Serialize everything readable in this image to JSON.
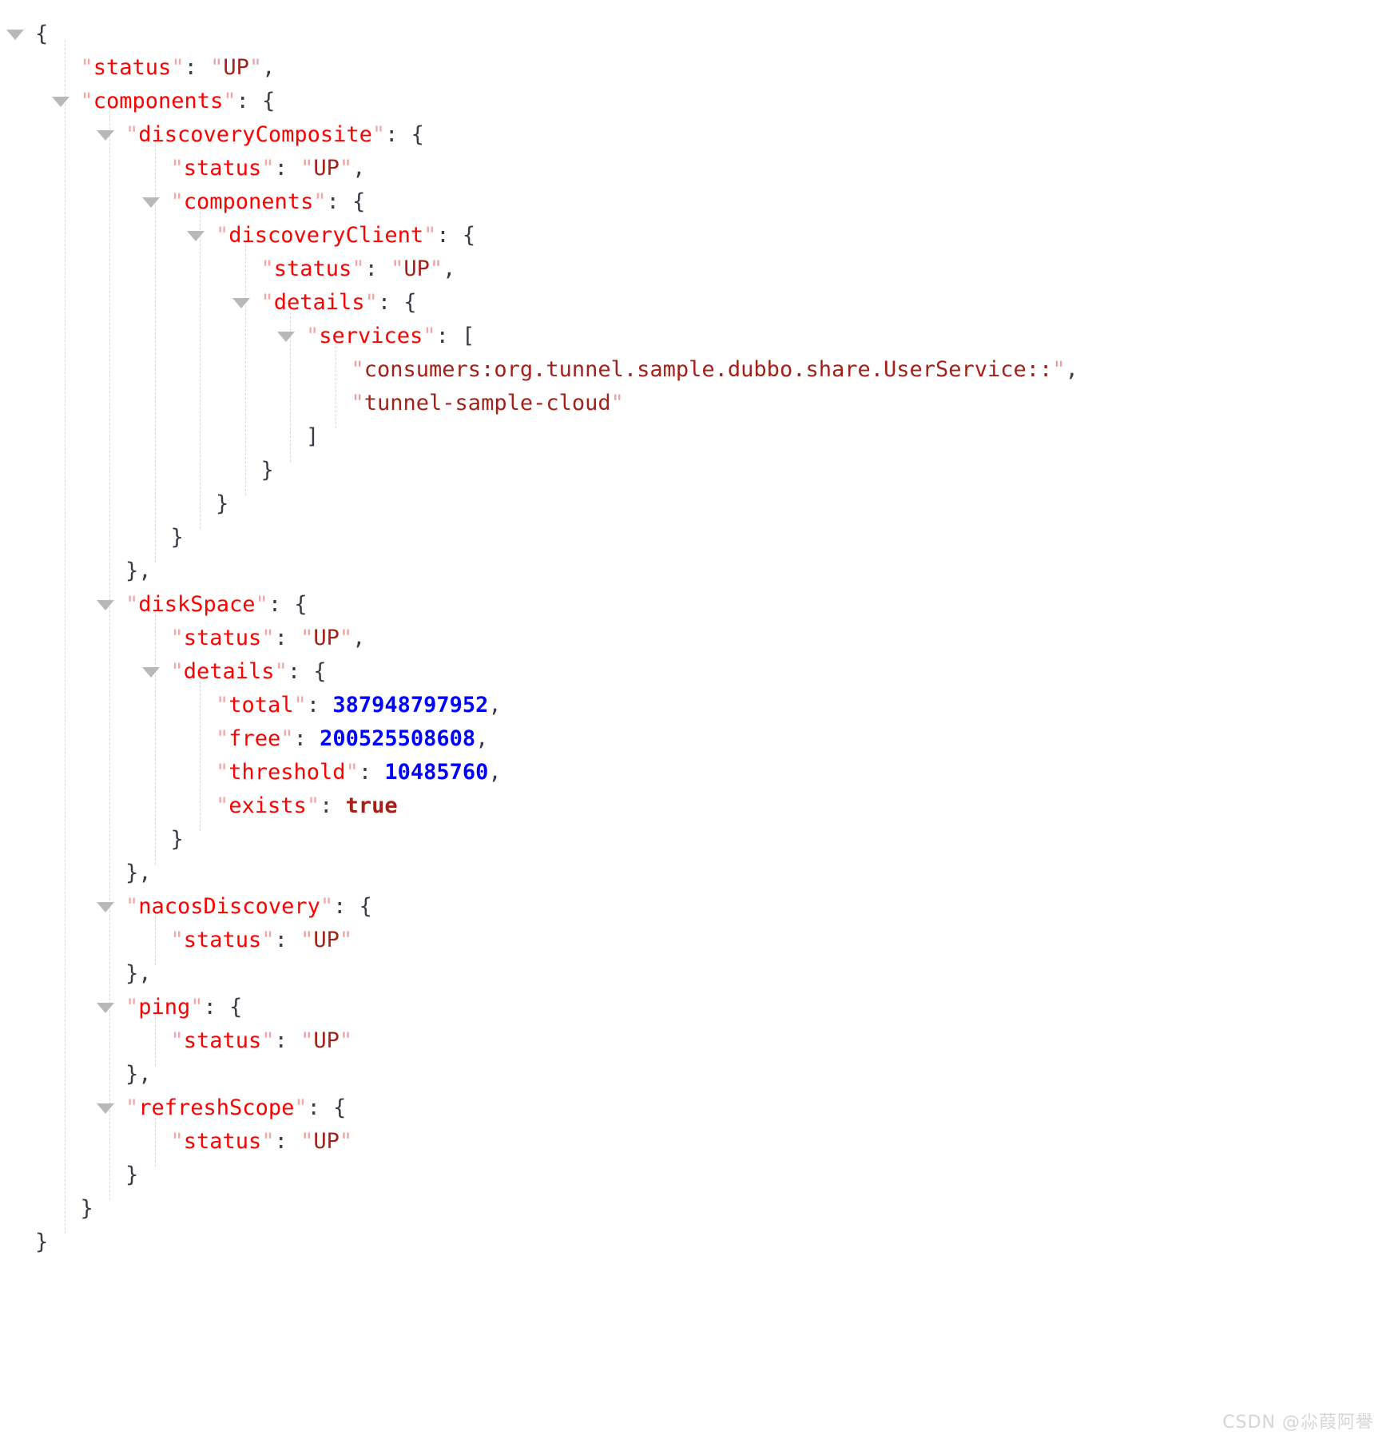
{
  "viewer": {
    "type": "json-tree-viewer",
    "colors": {
      "key": "#ff0000",
      "string_value": "#a52019",
      "number_value": "#0000ff",
      "boolean_value": "#a52019",
      "punctuation": "#3b3b46",
      "quote": "#f0a8a8",
      "guide_line": "#d8d8d8",
      "twisty": "#b8b8b8",
      "background": "#ffffff"
    }
  },
  "watermark": {
    "text": "CSDN @尛葭阿譽"
  },
  "json_document": {
    "status": "UP",
    "components": {
      "discoveryComposite": {
        "status": "UP",
        "components": {
          "discoveryClient": {
            "status": "UP",
            "details": {
              "services": [
                "consumers:org.tunnel.sample.dubbo.share.UserService::",
                "tunnel-sample-cloud"
              ]
            }
          }
        }
      },
      "diskSpace": {
        "status": "UP",
        "details": {
          "total": 387948797952,
          "free": 200525508608,
          "threshold": 10485760,
          "exists": true
        }
      },
      "nacosDiscovery": {
        "status": "UP"
      },
      "ping": {
        "status": "UP"
      },
      "refreshScope": {
        "status": "UP"
      }
    }
  },
  "lines": [
    {
      "id": "l0",
      "indent": 0,
      "twisty": true,
      "tokens": [
        {
          "t": "p",
          "v": "{"
        }
      ]
    },
    {
      "id": "l1",
      "indent": 1,
      "twisty": false,
      "tokens": [
        {
          "t": "q",
          "v": "\""
        },
        {
          "t": "k",
          "v": "status"
        },
        {
          "t": "q",
          "v": "\""
        },
        {
          "t": "p",
          "v": ": "
        },
        {
          "t": "qv",
          "v": "\""
        },
        {
          "t": "s",
          "v": "UP"
        },
        {
          "t": "qv",
          "v": "\""
        },
        {
          "t": "p",
          "v": ","
        }
      ]
    },
    {
      "id": "l2",
      "indent": 1,
      "twisty": true,
      "tokens": [
        {
          "t": "q",
          "v": "\""
        },
        {
          "t": "k",
          "v": "components"
        },
        {
          "t": "q",
          "v": "\""
        },
        {
          "t": "p",
          "v": ": {"
        }
      ]
    },
    {
      "id": "l3",
      "indent": 2,
      "twisty": true,
      "tokens": [
        {
          "t": "q",
          "v": "\""
        },
        {
          "t": "k",
          "v": "discoveryComposite"
        },
        {
          "t": "q",
          "v": "\""
        },
        {
          "t": "p",
          "v": ": {"
        }
      ]
    },
    {
      "id": "l4",
      "indent": 3,
      "twisty": false,
      "tokens": [
        {
          "t": "q",
          "v": "\""
        },
        {
          "t": "k",
          "v": "status"
        },
        {
          "t": "q",
          "v": "\""
        },
        {
          "t": "p",
          "v": ": "
        },
        {
          "t": "qv",
          "v": "\""
        },
        {
          "t": "s",
          "v": "UP"
        },
        {
          "t": "qv",
          "v": "\""
        },
        {
          "t": "p",
          "v": ","
        }
      ]
    },
    {
      "id": "l5",
      "indent": 3,
      "twisty": true,
      "tokens": [
        {
          "t": "q",
          "v": "\""
        },
        {
          "t": "k",
          "v": "components"
        },
        {
          "t": "q",
          "v": "\""
        },
        {
          "t": "p",
          "v": ": {"
        }
      ]
    },
    {
      "id": "l6",
      "indent": 4,
      "twisty": true,
      "tokens": [
        {
          "t": "q",
          "v": "\""
        },
        {
          "t": "k",
          "v": "discoveryClient"
        },
        {
          "t": "q",
          "v": "\""
        },
        {
          "t": "p",
          "v": ": {"
        }
      ]
    },
    {
      "id": "l7",
      "indent": 5,
      "twisty": false,
      "tokens": [
        {
          "t": "q",
          "v": "\""
        },
        {
          "t": "k",
          "v": "status"
        },
        {
          "t": "q",
          "v": "\""
        },
        {
          "t": "p",
          "v": ": "
        },
        {
          "t": "qv",
          "v": "\""
        },
        {
          "t": "s",
          "v": "UP"
        },
        {
          "t": "qv",
          "v": "\""
        },
        {
          "t": "p",
          "v": ","
        }
      ]
    },
    {
      "id": "l8",
      "indent": 5,
      "twisty": true,
      "tokens": [
        {
          "t": "q",
          "v": "\""
        },
        {
          "t": "k",
          "v": "details"
        },
        {
          "t": "q",
          "v": "\""
        },
        {
          "t": "p",
          "v": ": {"
        }
      ]
    },
    {
      "id": "l9",
      "indent": 6,
      "twisty": true,
      "tokens": [
        {
          "t": "q",
          "v": "\""
        },
        {
          "t": "k",
          "v": "services"
        },
        {
          "t": "q",
          "v": "\""
        },
        {
          "t": "p",
          "v": ": ["
        }
      ]
    },
    {
      "id": "l10",
      "indent": 7,
      "twisty": false,
      "tokens": [
        {
          "t": "qv",
          "v": "\""
        },
        {
          "t": "s",
          "v": "consumers:org.tunnel.sample.dubbo.share.UserService::"
        },
        {
          "t": "qv",
          "v": "\""
        },
        {
          "t": "p",
          "v": ","
        }
      ]
    },
    {
      "id": "l11",
      "indent": 7,
      "twisty": false,
      "tokens": [
        {
          "t": "qv",
          "v": "\""
        },
        {
          "t": "s",
          "v": "tunnel-sample-cloud"
        },
        {
          "t": "qv",
          "v": "\""
        }
      ]
    },
    {
      "id": "l12",
      "indent": 6,
      "twisty": false,
      "tokens": [
        {
          "t": "p",
          "v": "]"
        }
      ]
    },
    {
      "id": "l13",
      "indent": 5,
      "twisty": false,
      "tokens": [
        {
          "t": "p",
          "v": "}"
        }
      ]
    },
    {
      "id": "l14",
      "indent": 4,
      "twisty": false,
      "tokens": [
        {
          "t": "p",
          "v": "}"
        }
      ]
    },
    {
      "id": "l15",
      "indent": 3,
      "twisty": false,
      "tokens": [
        {
          "t": "p",
          "v": "}"
        }
      ]
    },
    {
      "id": "l16",
      "indent": 2,
      "twisty": false,
      "tokens": [
        {
          "t": "p",
          "v": "},"
        }
      ]
    },
    {
      "id": "l17",
      "indent": 2,
      "twisty": true,
      "tokens": [
        {
          "t": "q",
          "v": "\""
        },
        {
          "t": "k",
          "v": "diskSpace"
        },
        {
          "t": "q",
          "v": "\""
        },
        {
          "t": "p",
          "v": ": {"
        }
      ]
    },
    {
      "id": "l18",
      "indent": 3,
      "twisty": false,
      "tokens": [
        {
          "t": "q",
          "v": "\""
        },
        {
          "t": "k",
          "v": "status"
        },
        {
          "t": "q",
          "v": "\""
        },
        {
          "t": "p",
          "v": ": "
        },
        {
          "t": "qv",
          "v": "\""
        },
        {
          "t": "s",
          "v": "UP"
        },
        {
          "t": "qv",
          "v": "\""
        },
        {
          "t": "p",
          "v": ","
        }
      ]
    },
    {
      "id": "l19",
      "indent": 3,
      "twisty": true,
      "tokens": [
        {
          "t": "q",
          "v": "\""
        },
        {
          "t": "k",
          "v": "details"
        },
        {
          "t": "q",
          "v": "\""
        },
        {
          "t": "p",
          "v": ": {"
        }
      ]
    },
    {
      "id": "l20",
      "indent": 4,
      "twisty": false,
      "tokens": [
        {
          "t": "q",
          "v": "\""
        },
        {
          "t": "k",
          "v": "total"
        },
        {
          "t": "q",
          "v": "\""
        },
        {
          "t": "p",
          "v": ": "
        },
        {
          "t": "n",
          "v": "387948797952"
        },
        {
          "t": "p",
          "v": ","
        }
      ]
    },
    {
      "id": "l21",
      "indent": 4,
      "twisty": false,
      "tokens": [
        {
          "t": "q",
          "v": "\""
        },
        {
          "t": "k",
          "v": "free"
        },
        {
          "t": "q",
          "v": "\""
        },
        {
          "t": "p",
          "v": ": "
        },
        {
          "t": "n",
          "v": "200525508608"
        },
        {
          "t": "p",
          "v": ","
        }
      ]
    },
    {
      "id": "l22",
      "indent": 4,
      "twisty": false,
      "tokens": [
        {
          "t": "q",
          "v": "\""
        },
        {
          "t": "k",
          "v": "threshold"
        },
        {
          "t": "q",
          "v": "\""
        },
        {
          "t": "p",
          "v": ": "
        },
        {
          "t": "n",
          "v": "10485760"
        },
        {
          "t": "p",
          "v": ","
        }
      ]
    },
    {
      "id": "l23",
      "indent": 4,
      "twisty": false,
      "tokens": [
        {
          "t": "q",
          "v": "\""
        },
        {
          "t": "k",
          "v": "exists"
        },
        {
          "t": "q",
          "v": "\""
        },
        {
          "t": "p",
          "v": ": "
        },
        {
          "t": "b",
          "v": "true"
        }
      ]
    },
    {
      "id": "l24",
      "indent": 3,
      "twisty": false,
      "tokens": [
        {
          "t": "p",
          "v": "}"
        }
      ]
    },
    {
      "id": "l25",
      "indent": 2,
      "twisty": false,
      "tokens": [
        {
          "t": "p",
          "v": "},"
        }
      ]
    },
    {
      "id": "l26",
      "indent": 2,
      "twisty": true,
      "tokens": [
        {
          "t": "q",
          "v": "\""
        },
        {
          "t": "k",
          "v": "nacosDiscovery"
        },
        {
          "t": "q",
          "v": "\""
        },
        {
          "t": "p",
          "v": ": {"
        }
      ]
    },
    {
      "id": "l27",
      "indent": 3,
      "twisty": false,
      "tokens": [
        {
          "t": "q",
          "v": "\""
        },
        {
          "t": "k",
          "v": "status"
        },
        {
          "t": "q",
          "v": "\""
        },
        {
          "t": "p",
          "v": ": "
        },
        {
          "t": "qv",
          "v": "\""
        },
        {
          "t": "s",
          "v": "UP"
        },
        {
          "t": "qv",
          "v": "\""
        }
      ]
    },
    {
      "id": "l28",
      "indent": 2,
      "twisty": false,
      "tokens": [
        {
          "t": "p",
          "v": "},"
        }
      ]
    },
    {
      "id": "l29",
      "indent": 2,
      "twisty": true,
      "tokens": [
        {
          "t": "q",
          "v": "\""
        },
        {
          "t": "k",
          "v": "ping"
        },
        {
          "t": "q",
          "v": "\""
        },
        {
          "t": "p",
          "v": ": {"
        }
      ]
    },
    {
      "id": "l30",
      "indent": 3,
      "twisty": false,
      "tokens": [
        {
          "t": "q",
          "v": "\""
        },
        {
          "t": "k",
          "v": "status"
        },
        {
          "t": "q",
          "v": "\""
        },
        {
          "t": "p",
          "v": ": "
        },
        {
          "t": "qv",
          "v": "\""
        },
        {
          "t": "s",
          "v": "UP"
        },
        {
          "t": "qv",
          "v": "\""
        }
      ]
    },
    {
      "id": "l31",
      "indent": 2,
      "twisty": false,
      "tokens": [
        {
          "t": "p",
          "v": "},"
        }
      ]
    },
    {
      "id": "l32",
      "indent": 2,
      "twisty": true,
      "tokens": [
        {
          "t": "q",
          "v": "\""
        },
        {
          "t": "k",
          "v": "refreshScope"
        },
        {
          "t": "q",
          "v": "\""
        },
        {
          "t": "p",
          "v": ": {"
        }
      ]
    },
    {
      "id": "l33",
      "indent": 3,
      "twisty": false,
      "tokens": [
        {
          "t": "q",
          "v": "\""
        },
        {
          "t": "k",
          "v": "status"
        },
        {
          "t": "q",
          "v": "\""
        },
        {
          "t": "p",
          "v": ": "
        },
        {
          "t": "qv",
          "v": "\""
        },
        {
          "t": "s",
          "v": "UP"
        },
        {
          "t": "qv",
          "v": "\""
        }
      ]
    },
    {
      "id": "l34",
      "indent": 2,
      "twisty": false,
      "tokens": [
        {
          "t": "p",
          "v": "}"
        }
      ]
    },
    {
      "id": "l35",
      "indent": 1,
      "twisty": false,
      "tokens": [
        {
          "t": "p",
          "v": "}"
        }
      ]
    },
    {
      "id": "l36",
      "indent": 0,
      "twisty": false,
      "tokens": [
        {
          "t": "p",
          "v": "}"
        }
      ]
    }
  ],
  "guides": [
    {
      "indent": 1,
      "from": 1,
      "to": 36
    },
    {
      "indent": 2,
      "from": 3,
      "to": 35
    },
    {
      "indent": 3,
      "from": 4,
      "to": 16
    },
    {
      "indent": 4,
      "from": 6,
      "to": 15
    },
    {
      "indent": 5,
      "from": 7,
      "to": 14
    },
    {
      "indent": 6,
      "from": 9,
      "to": 13
    },
    {
      "indent": 7,
      "from": 10,
      "to": 12
    },
    {
      "indent": 3,
      "from": 18,
      "to": 25
    },
    {
      "indent": 4,
      "from": 20,
      "to": 24
    },
    {
      "indent": 3,
      "from": 27,
      "to": 28
    },
    {
      "indent": 3,
      "from": 30,
      "to": 31
    },
    {
      "indent": 3,
      "from": 33,
      "to": 34
    }
  ]
}
